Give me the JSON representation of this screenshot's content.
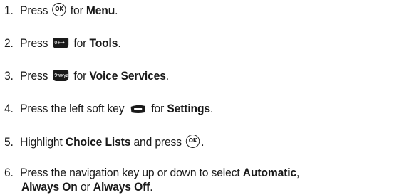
{
  "steps": [
    {
      "num": "1.",
      "t1": "Press",
      "key": "OK",
      "t2": "for",
      "bold": "Menu",
      "end": "."
    },
    {
      "num": "2.",
      "t1": "Press",
      "key": "0+→",
      "t2": "for",
      "bold": "Tools",
      "end": "."
    },
    {
      "num": "3.",
      "t1": "Press",
      "key": "9wxyz",
      "t2": "for",
      "bold": "Voice Services",
      "end": "."
    },
    {
      "num": "4.",
      "t1": "Press the left soft key",
      "t2": "for",
      "bold": "Settings",
      "end": "."
    },
    {
      "num": "5.",
      "t1": "Highlight",
      "bold": "Choice Lists",
      "t2": "and press",
      "key": "OK",
      "end": "."
    },
    {
      "num": "6.",
      "t1": "Press the navigation key up or down to select",
      "bold1": "Automatic",
      "comma": ",",
      "bold2": "Always On",
      "or": "or",
      "bold3": "Always Off",
      "end": "."
    }
  ]
}
